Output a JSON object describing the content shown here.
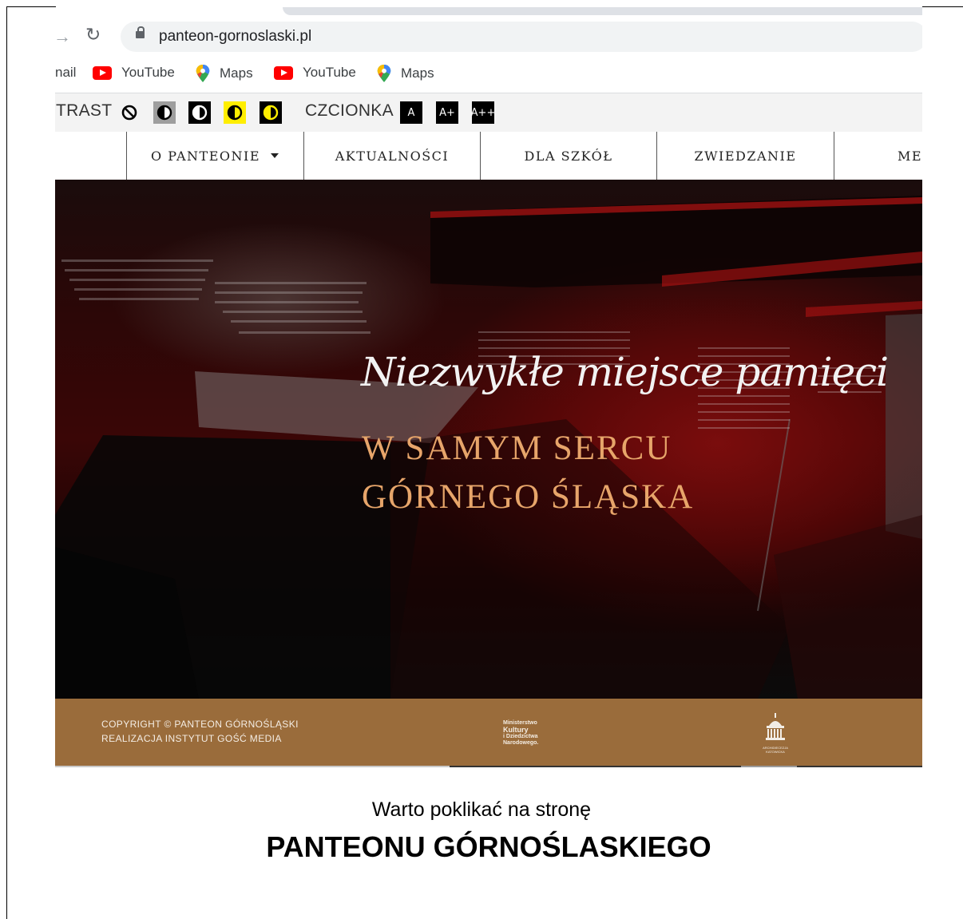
{
  "browser": {
    "url": "panteon-gornoslaski.pl",
    "bookmarks": [
      {
        "label": "nail",
        "icon": "gmail-icon"
      },
      {
        "label": "YouTube",
        "icon": "youtube-icon"
      },
      {
        "label": "Maps",
        "icon": "maps-icon"
      },
      {
        "label": "YouTube",
        "icon": "youtube-icon"
      },
      {
        "label": "Maps",
        "icon": "maps-icon"
      }
    ]
  },
  "accessibility": {
    "contrast_label": "TRAST",
    "font_label": "CZCIONKA",
    "font_buttons": [
      "A",
      "A+",
      "A++"
    ]
  },
  "nav": {
    "items": [
      "O PANTEONIE",
      "AKTUALNOŚCI",
      "DLA SZKÓŁ",
      "ZWIEDZANIE",
      "MEI"
    ]
  },
  "hero": {
    "script_title": "Niezwykłe miejsce pamięci",
    "line1": "W SAMYM SERCU",
    "line2": "GÓRNEGO ŚLĄSKA"
  },
  "footer": {
    "copyright": "COPYRIGHT © PANTEON GÓRNOŚLĄSKI",
    "realization": "REALIZACJA INSTYTUT GOŚĆ MEDIA",
    "ministry_lines": [
      "Ministerstwo",
      "Kultury",
      "i Dziedzictwa",
      "Narodowego."
    ],
    "arch_label": "ARCHIDIECEZJA KATOWICKA"
  },
  "caption": {
    "line1": "Warto poklikać na stronę",
    "line2": "PANTEONU GÓRNOŚLASKIEGO"
  },
  "colors": {
    "footer_brown": "#9a6c3b",
    "hero_gold": "#e7a56a",
    "youtube_red": "#ff0000",
    "contrast_yellow": "#ffee00"
  }
}
